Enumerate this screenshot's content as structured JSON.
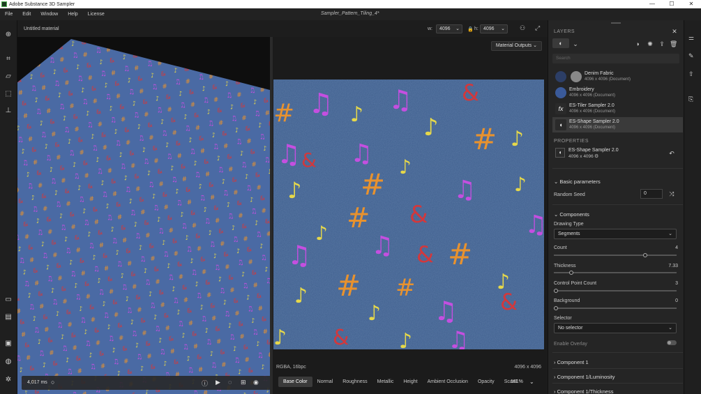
{
  "app": {
    "title": "Adobe Substance 3D Sampler",
    "document_title": "Sampler_Pattern_Tiling_4*"
  },
  "window_controls": {
    "minimize": "—",
    "maximize": "☐",
    "close": "✕"
  },
  "menu": [
    "File",
    "Edit",
    "Window",
    "Help",
    "License"
  ],
  "viewport": {
    "material_name": "Untitled material",
    "w_label": "w:",
    "w_value": "4096",
    "h_label": "h:",
    "h_value": "4096",
    "output_button": "Material Outputs",
    "render_time": "4,017 ms",
    "image_format": "RGBA, 16bpc",
    "image_size": "4096 x 4096",
    "zoom": "181%",
    "channels": [
      "Base Color",
      "Normal",
      "Roughness",
      "Metallic",
      "Height",
      "Ambient Occlusion",
      "Opacity",
      "Scan1"
    ],
    "active_channel": "Base Color"
  },
  "colors": {
    "accent": "#4caf50",
    "denim": "#3f5f8e",
    "purple": "#c44fe0",
    "red": "#d2383c",
    "yellow": "#e6d84a",
    "orange": "#e8922e"
  },
  "layers_panel": {
    "header": "LAYERS",
    "search_placeholder": "Search",
    "items": [
      {
        "name": "Denim Fabric",
        "size": "4096 x 4096 (Document)"
      },
      {
        "name": "Embroidery",
        "size": "4096 x 4096 (Document)"
      },
      {
        "name": "ES-Tiler Sampler 2.0",
        "size": "4096 x 4096 (Document)"
      },
      {
        "name": "ES-Shape Sampler 2.0",
        "size": "4096 x 4096 (Document)"
      }
    ]
  },
  "properties_panel": {
    "header": "PROPERTIES",
    "layer_name": "ES-Shape Sampler 2.0",
    "layer_size": "4096 x 4096",
    "basic_params_title": "Basic parameters",
    "random_seed_label": "Random Seed",
    "random_seed_value": "0",
    "components_title": "Components",
    "drawing_type_label": "Drawing Type",
    "drawing_type_value": "Segments",
    "count_label": "Count",
    "count_value": "4",
    "count_fraction": 0.75,
    "thickness_label": "Thickness",
    "thickness_value": "7.33",
    "thickness_fraction": 0.13,
    "control_point_label": "Control Point Count",
    "control_point_value": "3",
    "control_point_fraction": 0.0,
    "background_label": "Background",
    "background_value": "0",
    "background_fraction": 0.0,
    "selector_label": "Selector",
    "selector_value": "No selector",
    "enable_overlay_label": "Enable Overlay",
    "component1_title": "Component 1",
    "component1_lum_title": "Component 1/Luminosity",
    "component1_thick_title": "Component 1/Thickness"
  }
}
